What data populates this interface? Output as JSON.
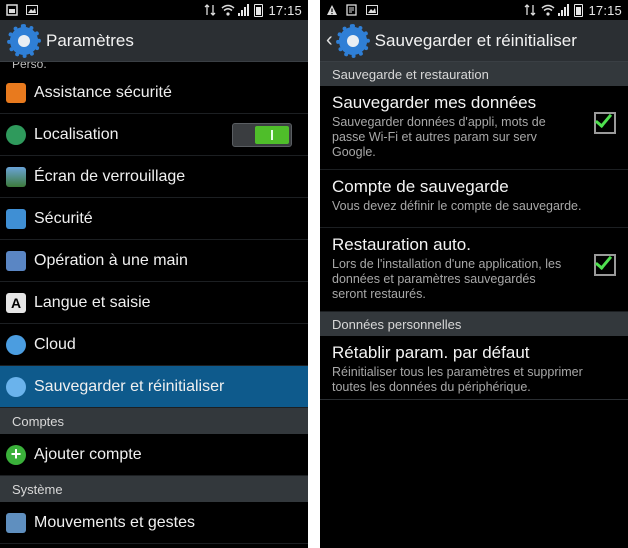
{
  "left": {
    "status": {
      "time": "17:15"
    },
    "header": {
      "title": "Paramètres"
    },
    "cut_label": "Perso.",
    "items": [
      {
        "label": "Assistance sécurité",
        "icon": "warning-icon"
      },
      {
        "label": "Localisation",
        "icon": "location-icon",
        "toggle": "on"
      },
      {
        "label": "Écran de verrouillage",
        "icon": "lock-screen-icon"
      },
      {
        "label": "Sécurité",
        "icon": "padlock-icon"
      },
      {
        "label": "Opération à une main",
        "icon": "one-hand-icon"
      },
      {
        "label": "Langue et saisie",
        "icon": "keyboard-a-icon"
      },
      {
        "label": "Cloud",
        "icon": "cloud-icon"
      },
      {
        "label": "Sauvegarder et réinitialiser",
        "icon": "backup-icon",
        "selected": true
      }
    ],
    "sections": {
      "comptes": "Comptes",
      "systeme": "Système"
    },
    "account_item": {
      "label": "Ajouter compte",
      "icon": "add-icon"
    },
    "system_item": {
      "label": "Mouvements et gestes",
      "icon": "motion-icon"
    }
  },
  "right": {
    "status": {
      "time": "17:15"
    },
    "header": {
      "title": "Sauvegarder et réinitialiser"
    },
    "section1": "Sauvegarde et restauration",
    "items": [
      {
        "title": "Sauvegarder mes données",
        "subtitle": "Sauvegarder données d'appli, mots de passe Wi-Fi et autres param sur serv Google.",
        "checked": true
      },
      {
        "title": "Compte de sauvegarde",
        "subtitle": "Vous devez définir le compte de sauvegarde."
      },
      {
        "title": "Restauration auto.",
        "subtitle": "Lors de l'installation d'une application, les données et paramètres sauvegardés seront restaurés.",
        "checked": true
      }
    ],
    "section2": "Données personnelles",
    "reset": {
      "title": "Rétablir param. par défaut",
      "subtitle": "Réinitialiser tous les paramètres et supprimer toutes les données du périphérique."
    }
  },
  "colors": {
    "accent": "#0e5a8c",
    "toggle_on": "#4fbe2a",
    "check": "#4fe04f",
    "header_bg": "#2b2f33",
    "section_bg": "#33383c"
  }
}
